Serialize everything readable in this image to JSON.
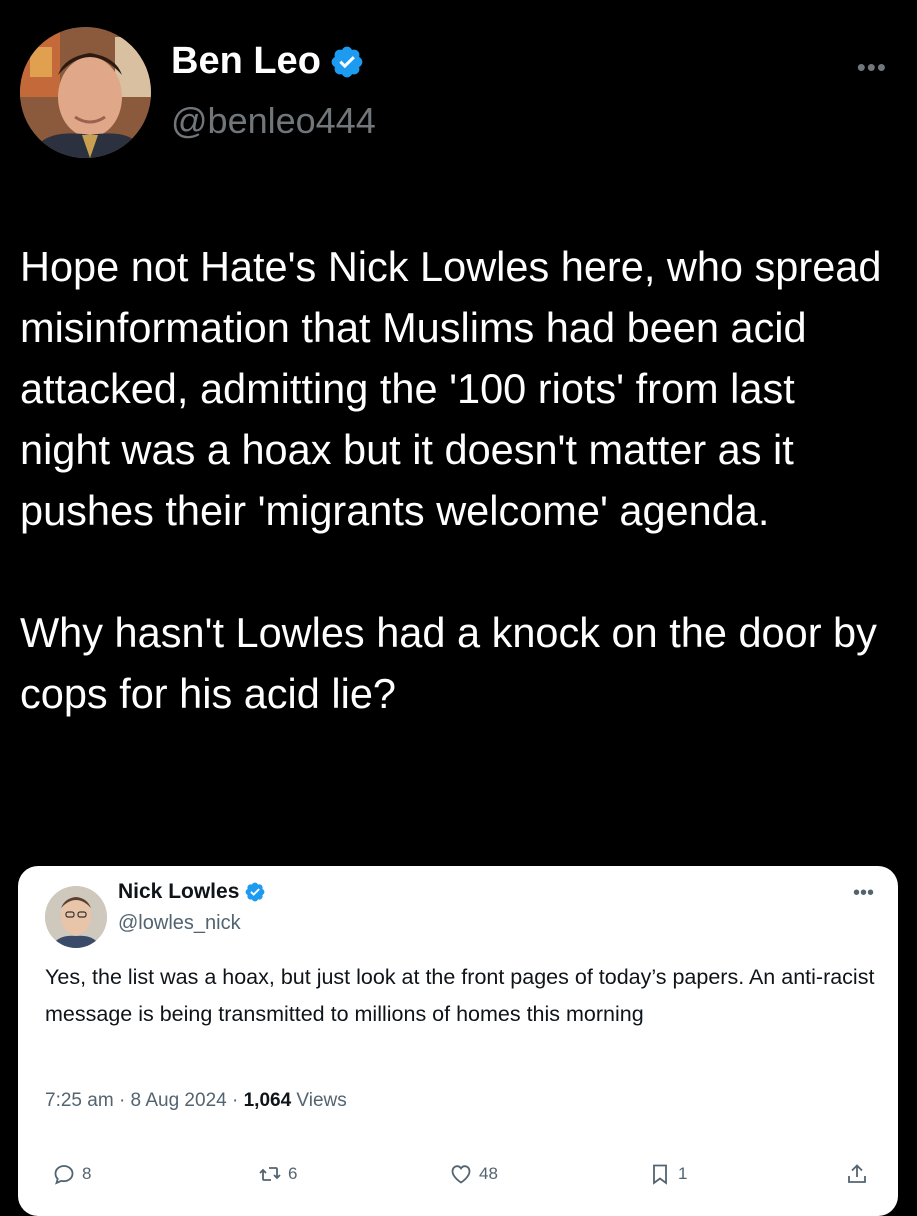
{
  "author": {
    "name": "Ben Leo",
    "handle": "@benleo444",
    "verified": true
  },
  "tweet": {
    "text": "Hope not Hate's Nick Lowles here, who spread misinformation that Muslims had been acid attacked, admitting the '100 riots' from last night was a hoax but it doesn't matter as it pushes their 'migrants welcome' agenda.\n\nWhy hasn't Lowles had a knock on the door by cops for his acid lie?"
  },
  "quote": {
    "name": "Nick Lowles",
    "handle": "@lowles_nick",
    "verified": true,
    "text": "Yes, the list was a hoax, but just look at the front pages of today’s papers. An anti-racist message is being transmitted to millions of homes this morning",
    "time": "7:25 am",
    "date": "8 Aug 2024",
    "views_count": "1,064",
    "views_label": "Views",
    "replies": "8",
    "reposts": "6",
    "likes": "48",
    "bookmarks": "1"
  },
  "icons": {
    "verified": "verified-badge-icon",
    "more": "more-icon",
    "reply": "reply-icon",
    "repost": "repost-icon",
    "like": "heart-icon",
    "bookmark": "bookmark-icon",
    "share": "share-icon"
  },
  "colors": {
    "background": "#000000",
    "text": "#ffffff",
    "secondary": "#71767b",
    "verified_blue": "#1d9bf0",
    "card_bg": "#ffffff",
    "card_secondary": "#536471"
  }
}
